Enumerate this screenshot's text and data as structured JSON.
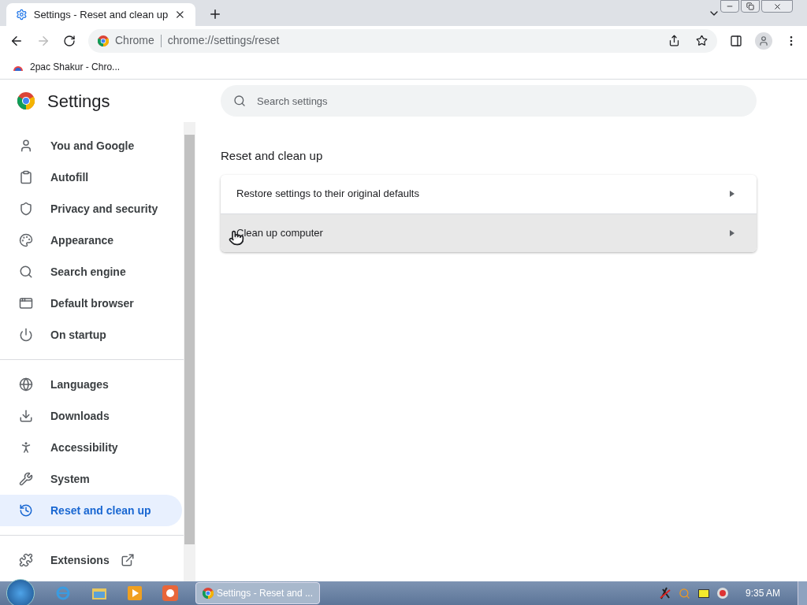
{
  "tab": {
    "title": "Settings - Reset and clean up"
  },
  "omnibox": {
    "chip": "Chrome",
    "url": "chrome://settings/reset"
  },
  "bookmarks": [
    {
      "label": "2pac Shakur - Chro..."
    }
  ],
  "header": {
    "title": "Settings"
  },
  "search": {
    "placeholder": "Search settings"
  },
  "sidebar": {
    "groups": [
      [
        {
          "label": "You and Google",
          "selected": false
        },
        {
          "label": "Autofill",
          "selected": false
        },
        {
          "label": "Privacy and security",
          "selected": false
        },
        {
          "label": "Appearance",
          "selected": false
        },
        {
          "label": "Search engine",
          "selected": false
        },
        {
          "label": "Default browser",
          "selected": false
        },
        {
          "label": "On startup",
          "selected": false
        }
      ],
      [
        {
          "label": "Languages",
          "selected": false
        },
        {
          "label": "Downloads",
          "selected": false
        },
        {
          "label": "Accessibility",
          "selected": false
        },
        {
          "label": "System",
          "selected": false
        },
        {
          "label": "Reset and clean up",
          "selected": true
        }
      ],
      [
        {
          "label": "Extensions",
          "selected": false,
          "external": true
        }
      ]
    ]
  },
  "section": {
    "title": "Reset and clean up",
    "rows": [
      {
        "label": "Restore settings to their original defaults",
        "hovered": false
      },
      {
        "label": "Clean up computer",
        "hovered": true
      }
    ]
  },
  "taskbar": {
    "window": "Settings - Reset and ...",
    "clock": "9:35 AM"
  }
}
